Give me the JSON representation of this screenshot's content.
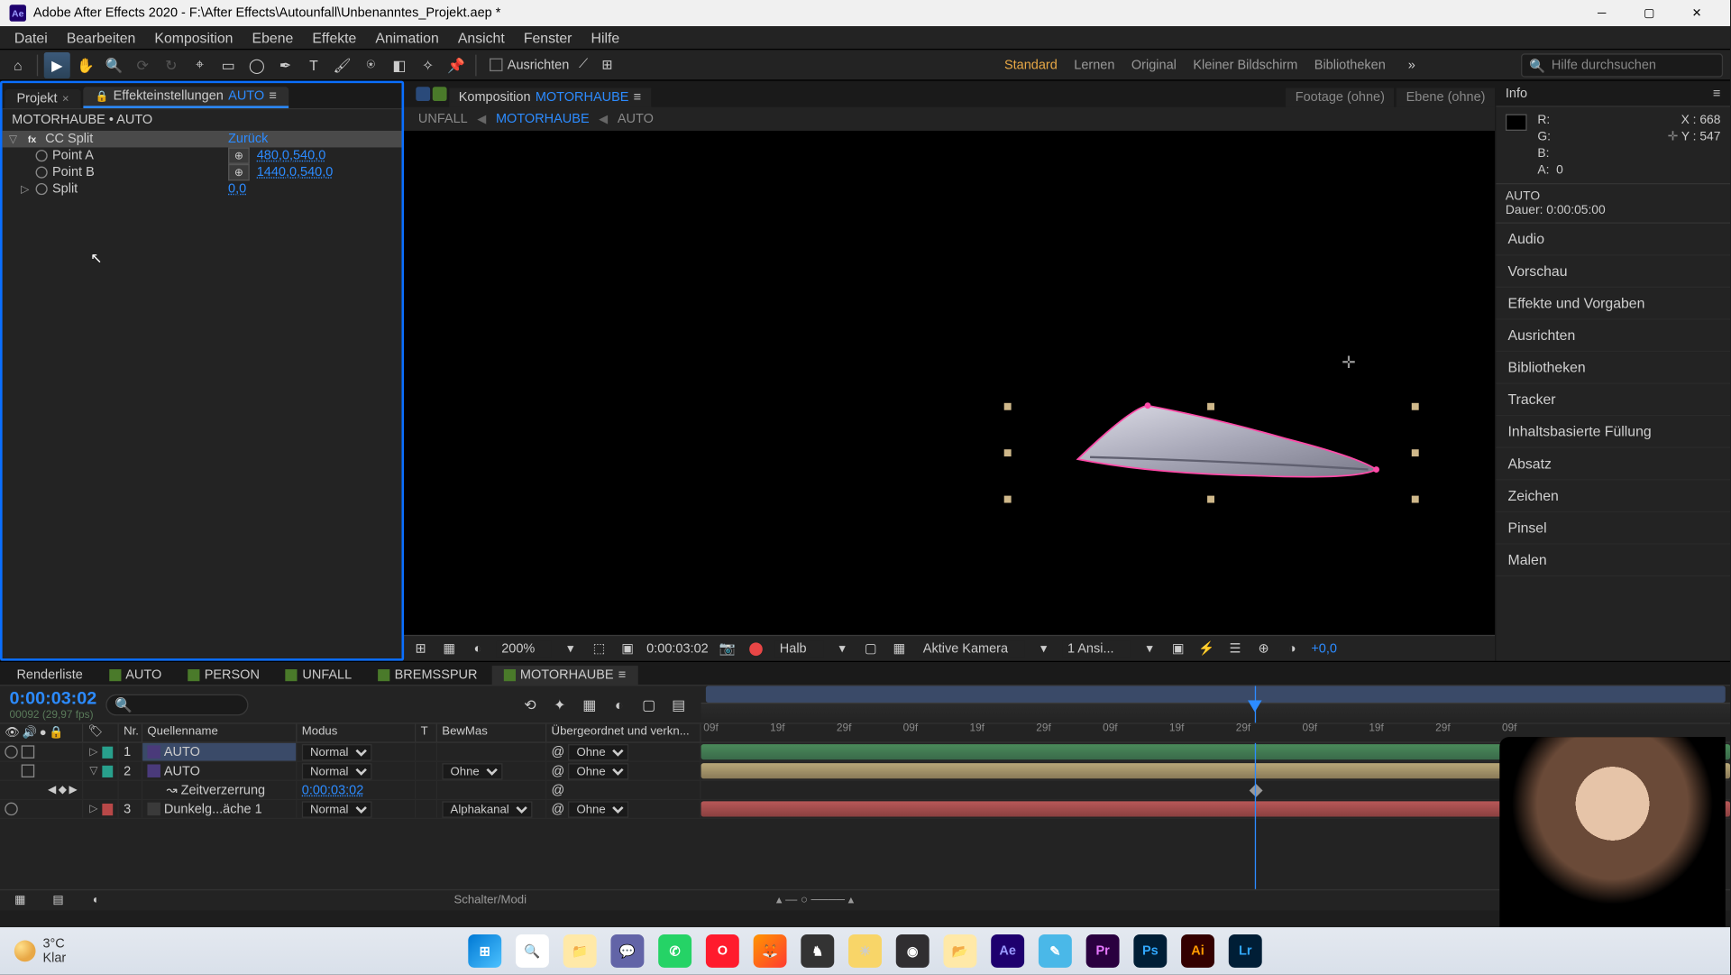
{
  "window": {
    "title": "Adobe After Effects 2020 - F:\\After Effects\\Autounfall\\Unbenanntes_Projekt.aep *"
  },
  "menu": [
    "Datei",
    "Bearbeiten",
    "Komposition",
    "Ebene",
    "Effekte",
    "Animation",
    "Ansicht",
    "Fenster",
    "Hilfe"
  ],
  "toolbar": {
    "ausrichten": "Ausrichten"
  },
  "workspaces": [
    "Standard",
    "Lernen",
    "Original",
    "Kleiner Bildschirm",
    "Bibliotheken"
  ],
  "search_help": "Hilfe durchsuchen",
  "left": {
    "tab_project": "Projekt",
    "tab_effect": "Effekteinstellungen",
    "tab_effect_target": "AUTO",
    "sub": "MOTORHAUBE • AUTO",
    "effect": {
      "name": "CC Split",
      "reset": "Zurück",
      "point_a": "Point A",
      "point_a_val": "480,0,540,0",
      "point_b": "Point B",
      "point_b_val": "1440,0,540,0",
      "split": "Split",
      "split_val": "0,0"
    }
  },
  "comp": {
    "label": "Komposition",
    "active": "MOTORHAUBE",
    "footage": "Footage (ohne)",
    "ebene": "Ebene (ohne)",
    "crumbs": [
      "UNFALL",
      "MOTORHAUBE",
      "AUTO"
    ]
  },
  "viewer_bar": {
    "zoom": "200%",
    "time": "0:00:03:02",
    "res": "Halb",
    "camera": "Aktive Kamera",
    "views": "1 Ansi...",
    "exposure": "+0,0"
  },
  "info": {
    "title": "Info",
    "r": "R:",
    "g": "G:",
    "b": "B:",
    "a": "A:",
    "a_val": "0",
    "xlabel": "X :",
    "xval": "668",
    "ylabel": "Y :",
    "yval": "547",
    "layer": "AUTO",
    "dur_label": "Dauer:",
    "dur": "0:00:05:00"
  },
  "side_panels": [
    "Audio",
    "Vorschau",
    "Effekte und Vorgaben",
    "Ausrichten",
    "Bibliotheken",
    "Tracker",
    "Inhaltsbasierte Füllung",
    "Absatz",
    "Zeichen",
    "Pinsel",
    "Malen"
  ],
  "timeline": {
    "tabs": [
      "Renderliste",
      "AUTO",
      "PERSON",
      "UNFALL",
      "BREMSSPUR",
      "MOTORHAUBE"
    ],
    "timecode": "0:00:03:02",
    "subtime": "00092 (29,97 fps)",
    "columns": {
      "nr": "Nr.",
      "name": "Quellenname",
      "modus": "Modus",
      "t": "T",
      "bewmas": "BewMas",
      "parent": "Übergeordnet und verkn..."
    },
    "ruler_ticks": [
      "09f",
      "19f",
      "29f",
      "09f",
      "19f",
      "29f",
      "09f",
      "19f",
      "29f",
      "09f",
      "19f",
      "29f",
      "09f"
    ],
    "layers": [
      {
        "nr": "1",
        "name": "AUTO",
        "modus": "Normal",
        "parent": "Ohne",
        "color": "#28a08c"
      },
      {
        "nr": "2",
        "name": "AUTO",
        "modus": "Normal",
        "bew": "Ohne",
        "parent": "Ohne",
        "color": "#28a08c"
      },
      {
        "nr": "3",
        "name": "Dunkelg...äche 1",
        "modus": "Normal",
        "bew": "Alphakanal",
        "parent": "Ohne",
        "color": "#b84848"
      }
    ],
    "prop": {
      "name": "Zeitverzerrung",
      "value": "0:00:03:02"
    }
  },
  "status": {
    "switches": "Schalter/Modi"
  },
  "taskbar": {
    "temp": "3°C",
    "cond": "Klar"
  }
}
